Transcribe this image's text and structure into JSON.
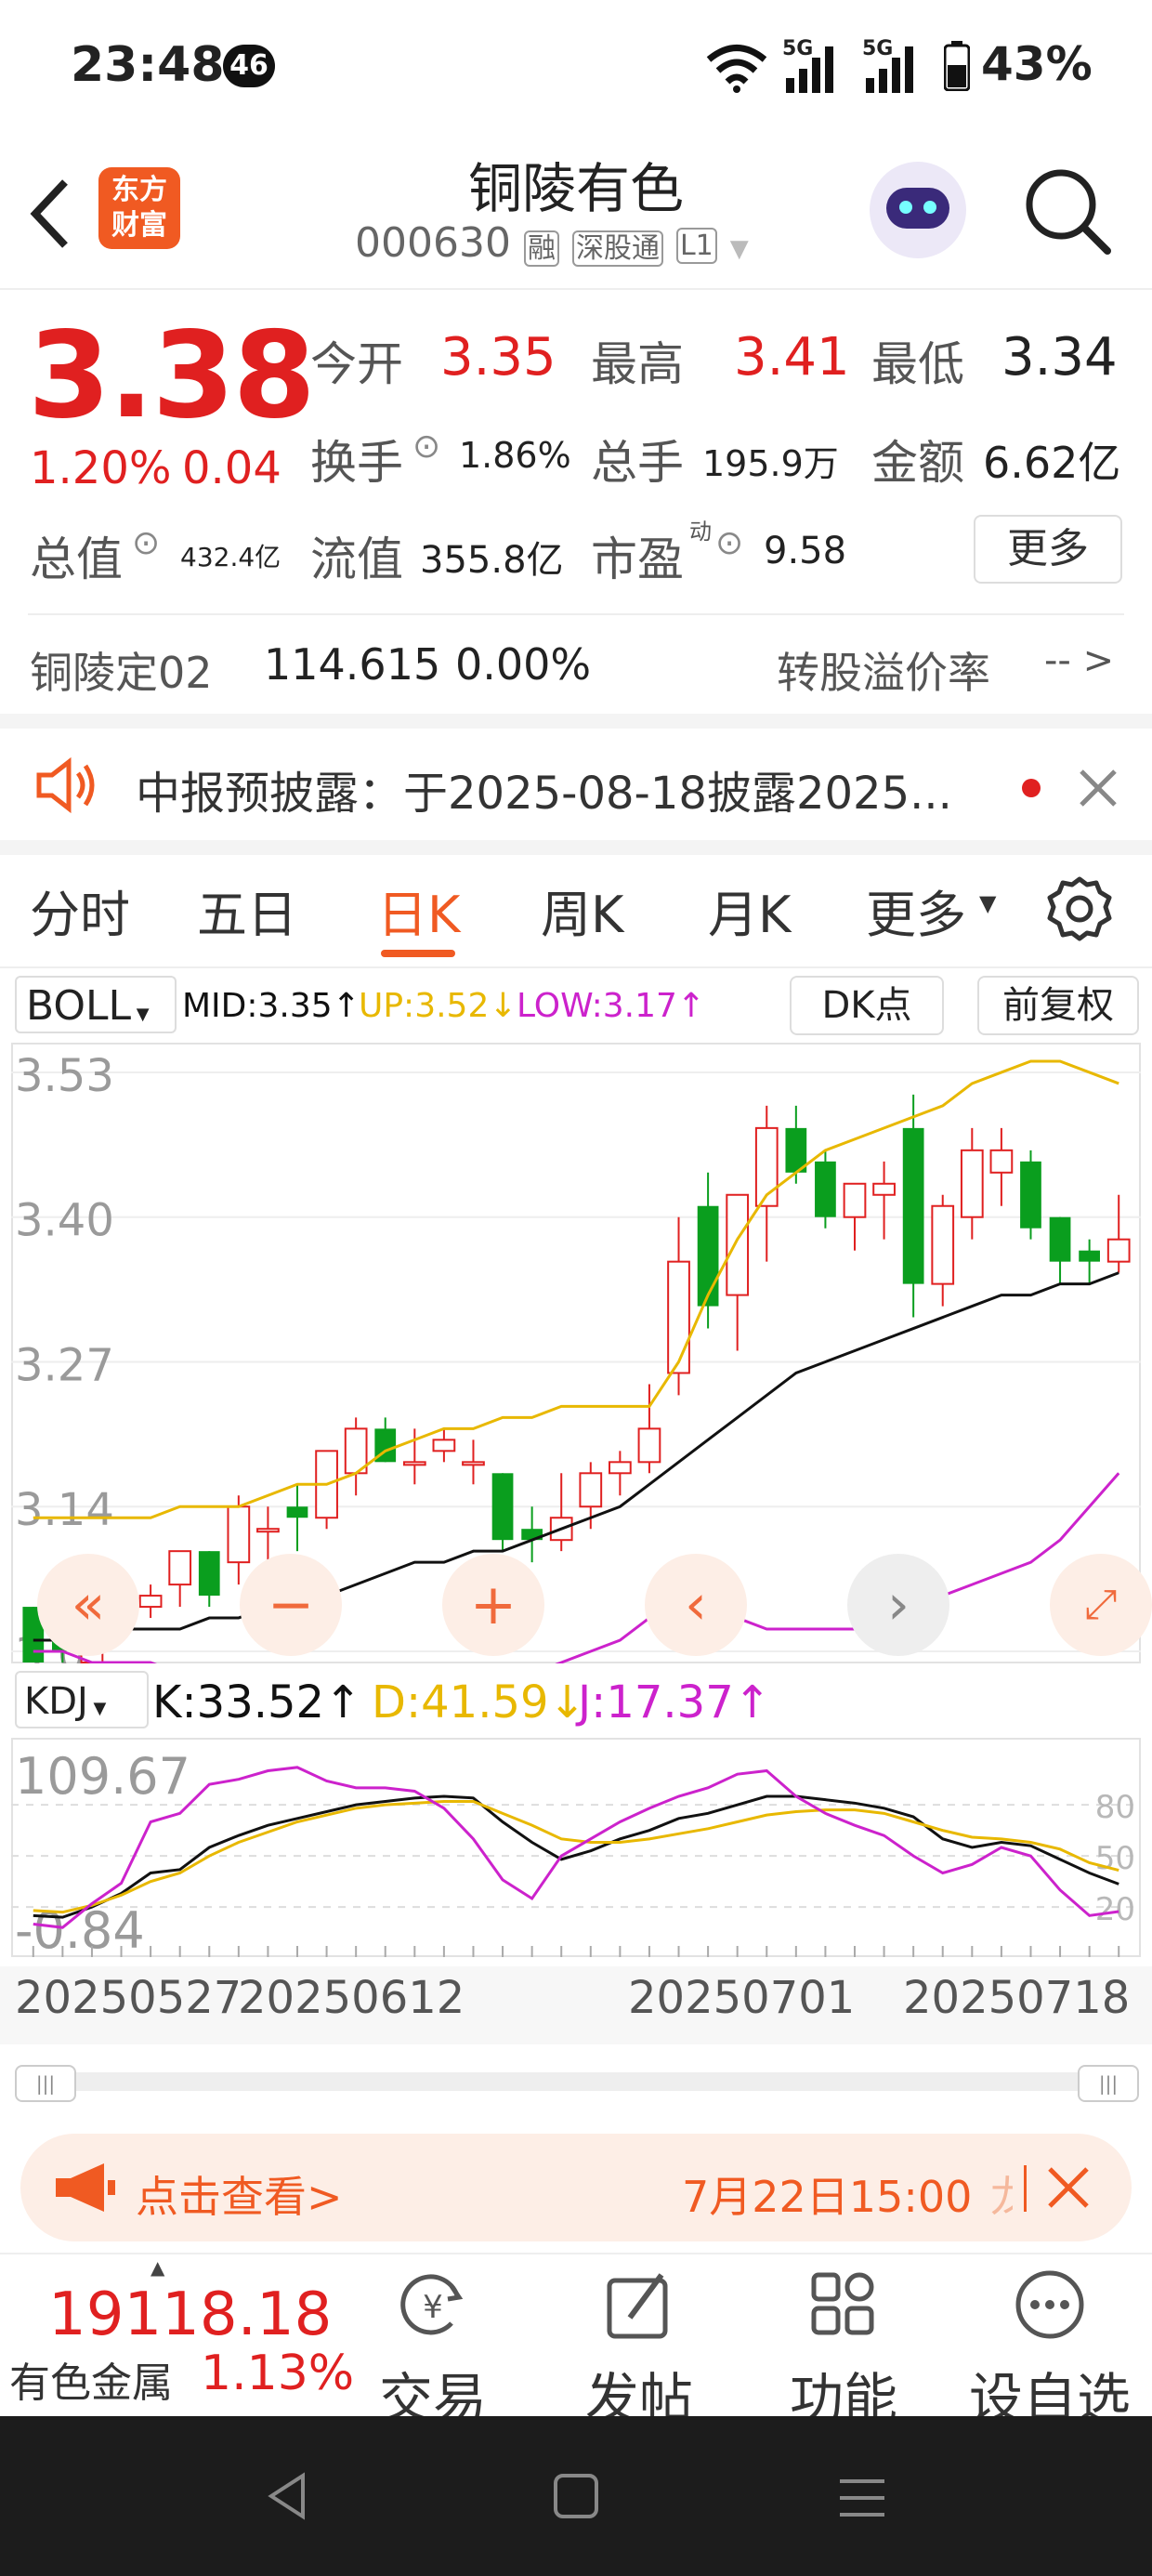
{
  "status_bar": {
    "time": "23:48",
    "notif_count": "46",
    "net1": "5G",
    "net2": "5G",
    "battery": "43%"
  },
  "header": {
    "back_icon": "chevron-left-icon",
    "logo_text": "东方\n财富",
    "name": "铜陵有色",
    "code": "000630",
    "badges": [
      "融",
      "深股通",
      "L1"
    ],
    "avatar_icon": "robot-avatar-icon",
    "search_icon": "search-icon"
  },
  "quote": {
    "price": "3.38",
    "change_pct": "1.20%",
    "change": "0.04",
    "open_label": "今开",
    "open": "3.35",
    "high_label": "最高",
    "high": "3.41",
    "low_label": "最低",
    "low": "3.34",
    "turnover_label": "换手",
    "turnover": "1.86%",
    "volume_label": "总手",
    "volume": "195.9万",
    "amount_label": "金额",
    "amount": "6.62亿",
    "mktcap_label": "总值",
    "mktcap": "432.4亿",
    "float_label": "流值",
    "float": "355.8亿",
    "pe_label": "市盈",
    "pe_sup": "动",
    "pe": "9.58",
    "more": "更多"
  },
  "bond": {
    "name": "铜陵定02",
    "price": "114.615",
    "pct": "0.00%",
    "premium_label": "转股溢价率",
    "premium": "-- >"
  },
  "notice": {
    "text": "中报预披露：于2025-08-18披露2025..."
  },
  "tabs": [
    "分时",
    "五日",
    "日K",
    "周K",
    "月K",
    "更多"
  ],
  "active_tab": "日K",
  "chart_controls": {
    "indicator": "BOLL",
    "mid": "MID:3.35↑",
    "up": "UP:3.52↓",
    "low": "LOW:3.17↑",
    "dk": "DK点",
    "adjust": "前复权"
  },
  "kdj_controls": {
    "indicator": "KDJ",
    "k": "K:33.52↑",
    "d": "D:41.59↓",
    "j": "J:17.37↑"
  },
  "date_labels": [
    "20250527",
    "20250612",
    "20250701",
    "20250718"
  ],
  "promo": {
    "text": "点击查看>",
    "time": "7月22日15:00",
    "tail": "龙"
  },
  "bottom_nav": {
    "index_value": "19118.18",
    "index_name": "有色金属",
    "index_pct": "1.13%",
    "items": [
      "交易",
      "发帖",
      "功能",
      "设自选"
    ]
  },
  "colors": {
    "up": "#e02020",
    "down": "#0a9e1e",
    "accent": "#f05a22",
    "mid_line": "#111111",
    "up_band": "#e8b800",
    "low_band": "#cc22cc"
  },
  "chart_data": [
    {
      "type": "candlestick",
      "title": "BOLL",
      "y_ticks": [
        3.53,
        3.4,
        3.27,
        3.14,
        3.01
      ],
      "ylim": [
        3.01,
        3.55
      ],
      "x_tick_labels": [
        "20250527",
        "20250612",
        "20250701",
        "20250718"
      ],
      "candles": [
        {
          "o": 3.05,
          "h": 3.05,
          "l": 3.0,
          "c": 3.0
        },
        {
          "o": 3.02,
          "h": 3.02,
          "l": 3.0,
          "c": 3.01
        },
        {
          "o": 3.0,
          "h": 3.06,
          "l": 2.99,
          "c": 3.05
        },
        {
          "o": 3.05,
          "h": 3.07,
          "l": 3.03,
          "c": 3.05
        },
        {
          "o": 3.05,
          "h": 3.07,
          "l": 3.04,
          "c": 3.06
        },
        {
          "o": 3.07,
          "h": 3.1,
          "l": 3.05,
          "c": 3.1
        },
        {
          "o": 3.1,
          "h": 3.1,
          "l": 3.05,
          "c": 3.06
        },
        {
          "o": 3.09,
          "h": 3.15,
          "l": 3.07,
          "c": 3.14
        },
        {
          "o": 3.12,
          "h": 3.14,
          "l": 3.09,
          "c": 3.12
        },
        {
          "o": 3.14,
          "h": 3.16,
          "l": 3.1,
          "c": 3.13
        },
        {
          "o": 3.13,
          "h": 3.19,
          "l": 3.12,
          "c": 3.19
        },
        {
          "o": 3.17,
          "h": 3.22,
          "l": 3.15,
          "c": 3.21
        },
        {
          "o": 3.21,
          "h": 3.22,
          "l": 3.18,
          "c": 3.18
        },
        {
          "o": 3.18,
          "h": 3.21,
          "l": 3.16,
          "c": 3.18
        },
        {
          "o": 3.19,
          "h": 3.21,
          "l": 3.18,
          "c": 3.2
        },
        {
          "o": 3.18,
          "h": 3.2,
          "l": 3.16,
          "c": 3.18
        },
        {
          "o": 3.17,
          "h": 3.17,
          "l": 3.1,
          "c": 3.11
        },
        {
          "o": 3.12,
          "h": 3.14,
          "l": 3.09,
          "c": 3.11
        },
        {
          "o": 3.11,
          "h": 3.17,
          "l": 3.1,
          "c": 3.13
        },
        {
          "o": 3.14,
          "h": 3.18,
          "l": 3.12,
          "c": 3.17
        },
        {
          "o": 3.17,
          "h": 3.19,
          "l": 3.15,
          "c": 3.18
        },
        {
          "o": 3.18,
          "h": 3.25,
          "l": 3.17,
          "c": 3.21
        },
        {
          "o": 3.26,
          "h": 3.4,
          "l": 3.24,
          "c": 3.36
        },
        {
          "o": 3.41,
          "h": 3.44,
          "l": 3.3,
          "c": 3.32
        },
        {
          "o": 3.33,
          "h": 3.42,
          "l": 3.28,
          "c": 3.42
        },
        {
          "o": 3.41,
          "h": 3.5,
          "l": 3.36,
          "c": 3.48
        },
        {
          "o": 3.48,
          "h": 3.5,
          "l": 3.43,
          "c": 3.44
        },
        {
          "o": 3.45,
          "h": 3.46,
          "l": 3.39,
          "c": 3.4
        },
        {
          "o": 3.4,
          "h": 3.43,
          "l": 3.37,
          "c": 3.43
        },
        {
          "o": 3.42,
          "h": 3.45,
          "l": 3.38,
          "c": 3.43
        },
        {
          "o": 3.48,
          "h": 3.51,
          "l": 3.31,
          "c": 3.34
        },
        {
          "o": 3.34,
          "h": 3.42,
          "l": 3.32,
          "c": 3.41
        },
        {
          "o": 3.4,
          "h": 3.48,
          "l": 3.38,
          "c": 3.46
        },
        {
          "o": 3.44,
          "h": 3.48,
          "l": 3.41,
          "c": 3.46
        },
        {
          "o": 3.45,
          "h": 3.46,
          "l": 3.38,
          "c": 3.39
        },
        {
          "o": 3.4,
          "h": 3.4,
          "l": 3.34,
          "c": 3.36
        },
        {
          "o": 3.37,
          "h": 3.38,
          "l": 3.34,
          "c": 3.36
        },
        {
          "o": 3.36,
          "h": 3.42,
          "l": 3.35,
          "c": 3.38
        }
      ],
      "series": [
        {
          "name": "MID",
          "values": [
            3.02,
            3.02,
            3.02,
            3.03,
            3.03,
            3.03,
            3.04,
            3.04,
            3.05,
            3.05,
            3.06,
            3.07,
            3.08,
            3.09,
            3.09,
            3.1,
            3.1,
            3.11,
            3.12,
            3.13,
            3.14,
            3.16,
            3.18,
            3.2,
            3.22,
            3.24,
            3.26,
            3.27,
            3.28,
            3.29,
            3.3,
            3.31,
            3.32,
            3.33,
            3.33,
            3.34,
            3.34,
            3.35
          ]
        },
        {
          "name": "UP",
          "values": [
            3.13,
            3.13,
            3.13,
            3.13,
            3.13,
            3.14,
            3.14,
            3.14,
            3.15,
            3.16,
            3.16,
            3.17,
            3.19,
            3.2,
            3.21,
            3.21,
            3.22,
            3.22,
            3.23,
            3.23,
            3.23,
            3.23,
            3.27,
            3.33,
            3.38,
            3.42,
            3.44,
            3.46,
            3.47,
            3.48,
            3.49,
            3.5,
            3.52,
            3.53,
            3.54,
            3.54,
            3.53,
            3.52
          ]
        },
        {
          "name": "LOW",
          "values": [
            3.01,
            3.01,
            3.0,
            3.0,
            3.0,
            2.99,
            2.99,
            2.99,
            2.98,
            2.98,
            2.98,
            2.98,
            2.98,
            2.98,
            2.98,
            2.98,
            2.98,
            2.99,
            3.0,
            3.01,
            3.02,
            3.04,
            3.05,
            3.05,
            3.04,
            3.03,
            3.03,
            3.03,
            3.03,
            3.04,
            3.05,
            3.06,
            3.07,
            3.08,
            3.09,
            3.11,
            3.14,
            3.17
          ]
        }
      ]
    },
    {
      "type": "line",
      "title": "KDJ",
      "y_ticks": [
        109.67,
        -0.84
      ],
      "right_ticks": [
        80,
        50,
        20
      ],
      "ylim": [
        -5,
        115
      ],
      "series": [
        {
          "name": "K",
          "values": [
            15,
            14,
            20,
            28,
            40,
            42,
            55,
            62,
            68,
            72,
            76,
            80,
            82,
            84,
            85,
            84,
            70,
            58,
            48,
            53,
            60,
            65,
            72,
            75,
            80,
            85,
            85,
            83,
            81,
            78,
            73,
            60,
            55,
            58,
            56,
            48,
            40,
            33.52
          ]
        },
        {
          "name": "D",
          "values": [
            18,
            17,
            21,
            27,
            35,
            40,
            50,
            58,
            64,
            70,
            74,
            78,
            80,
            81,
            82,
            82,
            75,
            68,
            60,
            58,
            58,
            60,
            63,
            66,
            70,
            74,
            76,
            77,
            77,
            75,
            70,
            65,
            61,
            60,
            58,
            54,
            46,
            41.59
          ]
        },
        {
          "name": "J",
          "values": [
            10,
            8,
            22,
            34,
            70,
            75,
            92,
            95,
            100,
            102,
            94,
            90,
            90,
            88,
            78,
            60,
            36,
            25,
            50,
            60,
            70,
            78,
            85,
            90,
            98,
            100,
            85,
            75,
            68,
            62,
            50,
            40,
            45,
            55,
            50,
            30,
            15,
            17.37
          ]
        }
      ]
    }
  ]
}
